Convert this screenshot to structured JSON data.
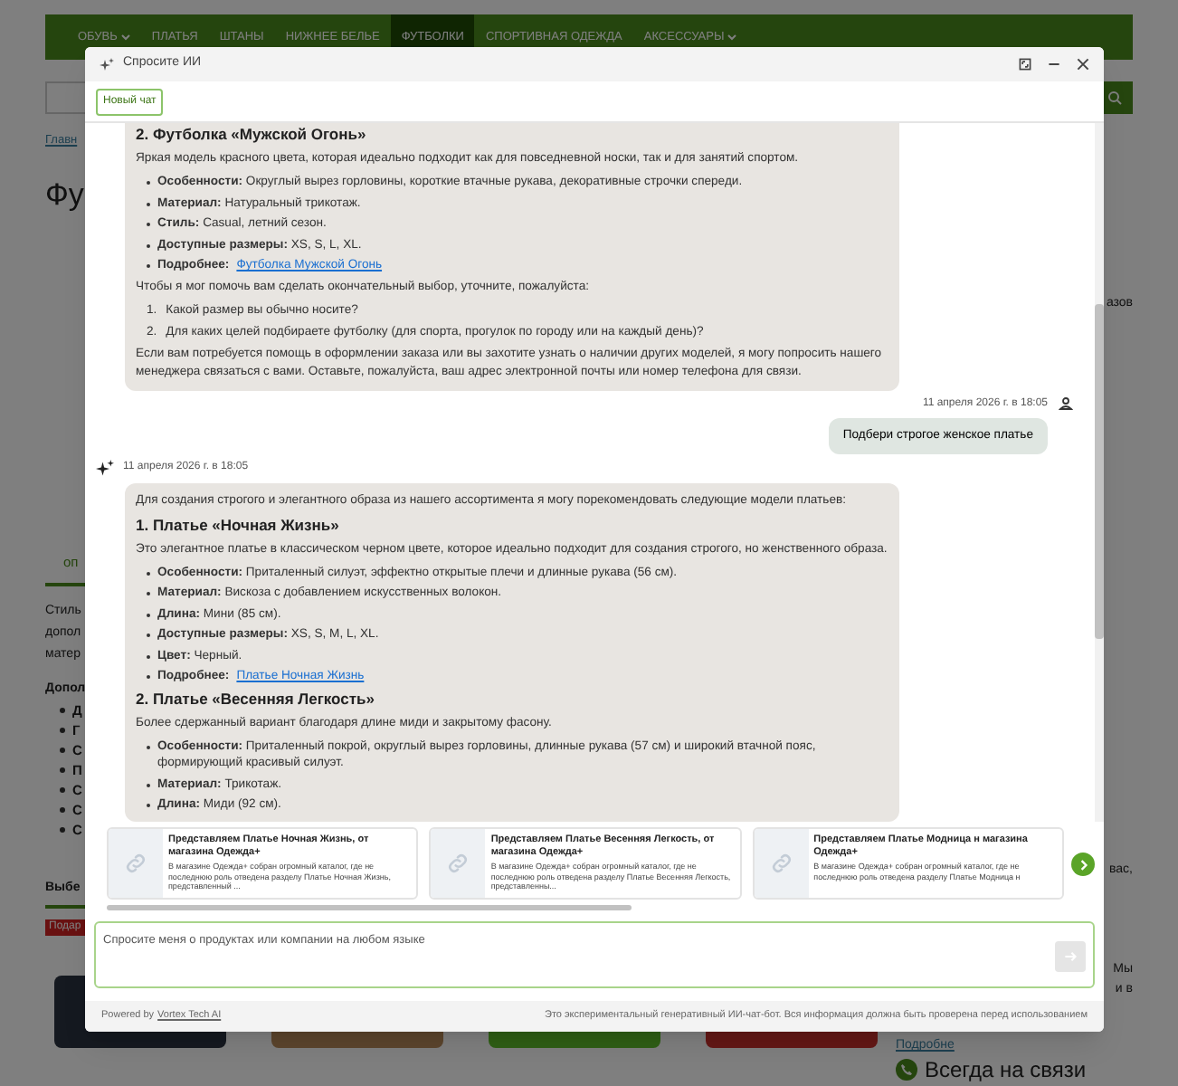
{
  "page": {
    "nav": [
      {
        "label": "ОБУВЬ",
        "dropdown": true,
        "selected": false
      },
      {
        "label": "ПЛАТЬЯ",
        "dropdown": false,
        "selected": false
      },
      {
        "label": "ШТАНЫ",
        "dropdown": false,
        "selected": false
      },
      {
        "label": "НИЖНЕЕ БЕЛЬЕ",
        "dropdown": false,
        "selected": false
      },
      {
        "label": "ФУТБОЛКИ",
        "dropdown": false,
        "selected": true
      },
      {
        "label": "СПОРТИВНАЯ ОДЕЖДА",
        "dropdown": false,
        "selected": false
      },
      {
        "label": "АКСЕССУАРЫ",
        "dropdown": true,
        "selected": false
      }
    ],
    "breadcrumb": "Главн",
    "heading": "Фу",
    "tab": "оп",
    "description_lines": [
      "Стиль",
      "допол",
      "матер"
    ],
    "details_title": "Допол",
    "details_items": [
      "Д",
      "Г",
      "С",
      "П",
      "С",
      "С",
      "С"
    ],
    "section_title": "Выбе",
    "badge": "Подар",
    "right_top": "азов",
    "right_lines": [
      "вас,",
      "Мы",
      "и в"
    ],
    "right_link": "Подробне",
    "contact": "Всегда на связи"
  },
  "chat": {
    "title": "Спросите ИИ",
    "new_chat": "Новый чат",
    "messages": [
      {
        "kind": "bot",
        "blocks": [
          {
            "kind": "heading",
            "text": "2. Футболка «Мужской Огонь»"
          },
          {
            "kind": "paragraph",
            "text": "Яркая модель красного цвета, которая идеально подходит как для повседневной носки, так и для занятий спортом."
          },
          {
            "kind": "bullets",
            "items": [
              {
                "label": "Особенности:",
                "text": "Округлый вырез горловины, короткие втачные рукава, декоративные строчки спереди."
              },
              {
                "label": "Материал:",
                "text": "Натуральный трикотаж."
              },
              {
                "label": "Стиль:",
                "text": "Casual, летний сезон."
              },
              {
                "label": "Доступные размеры:",
                "text": "XS, S, L, XL."
              },
              {
                "label": "Подробнее:",
                "link": "Футболка Мужской Огонь"
              }
            ]
          },
          {
            "kind": "paragraph",
            "text": "Чтобы я мог помочь вам сделать окончательный выбор, уточните, пожалуйста:"
          },
          {
            "kind": "numbered",
            "items": [
              {
                "number": "1.",
                "text": "Какой размер вы обычно носите?"
              },
              {
                "number": "2.",
                "text": "Для каких целей подбираете футболку (для спорта, прогулок по городу или на каждый день)?"
              }
            ]
          },
          {
            "kind": "paragraph",
            "text": "Если вам потребуется помощь в оформлении заказа или вы захотите узнать о наличии других моделей, я могу попросить нашего менеджера связаться с вами. Оставьте, пожалуйста, ваш адрес электронной почты или номер телефона для связи."
          }
        ]
      },
      {
        "kind": "user",
        "time": "11 апреля 2026 г. в 18:05",
        "text": "Подбери строгое женское платье"
      },
      {
        "kind": "bot",
        "time": "11 апреля 2026 г. в 18:05",
        "blocks": [
          {
            "kind": "paragraph",
            "text": "Для создания строгого и элегантного образа из нашего ассортимента я могу порекомендовать следующие модели платьев:"
          },
          {
            "kind": "heading",
            "text": "1. Платье «Ночная Жизнь»"
          },
          {
            "kind": "paragraph",
            "text": "Это элегантное платье в классическом черном цвете, которое идеально подходит для создания строгого, но женственного образа."
          },
          {
            "kind": "bullets",
            "items": [
              {
                "label": "Особенности:",
                "text": "Приталенный силуэт, эффектно открытые плечи и длинные рукава (56 см)."
              },
              {
                "label": "Материал:",
                "text": "Вискоза с добавлением искусственных волокон."
              },
              {
                "label": "Длина:",
                "text": "Мини (85 см)."
              },
              {
                "label": "Доступные размеры:",
                "text": "XS, S, M, L, XL."
              },
              {
                "label": "Цвет:",
                "text": "Черный."
              },
              {
                "label": "Подробнее:",
                "link": "Платье Ночная Жизнь"
              }
            ]
          },
          {
            "kind": "heading",
            "text": "2. Платье «Весенняя Легкость»"
          },
          {
            "kind": "paragraph",
            "text": "Более сдержанный вариант благодаря длине миди и закрытому фасону."
          },
          {
            "kind": "bullets",
            "items": [
              {
                "label": "Особенности:",
                "text": "Приталенный покрой, округлый вырез горловины, длинные рукава (57 см) и широкий втачной пояс, формирующий красивый силуэт."
              },
              {
                "label": "Материал:",
                "text": "Трикотаж."
              },
              {
                "label": "Длина:",
                "text": "Миди (92 см)."
              }
            ]
          }
        ]
      }
    ],
    "cards": [
      {
        "title": "Представляем Платье Ночная Жизнь, от магазина Одежда+",
        "description": "В магазине Одежда+ собран огромный каталог, где не последнюю роль отведена разделу Платье Ночная Жизнь, представленный ..."
      },
      {
        "title": "Представляем Платье Весенняя Легкость, от магазина Одежда+",
        "description": "В магазине Одежда+ собран огромный каталог, где не последнюю роль отведена разделу Платье Весенняя Легкость, представленны..."
      },
      {
        "title": "Представляем Платье Модница н магазина Одежда+",
        "description": "В магазине Одежда+ собран огромный каталог, где не последнюю роль отведена разделу Платье Модница н"
      }
    ],
    "input_placeholder": "Спросите меня о продуктах или компании на любом языке",
    "powered_by": "Powered by",
    "powered_link": "Vortex Tech AI",
    "disclaimer": "Это экспериментальный генеративный ИИ-чат-бот. Вся информация должна быть проверена перед использованием"
  }
}
